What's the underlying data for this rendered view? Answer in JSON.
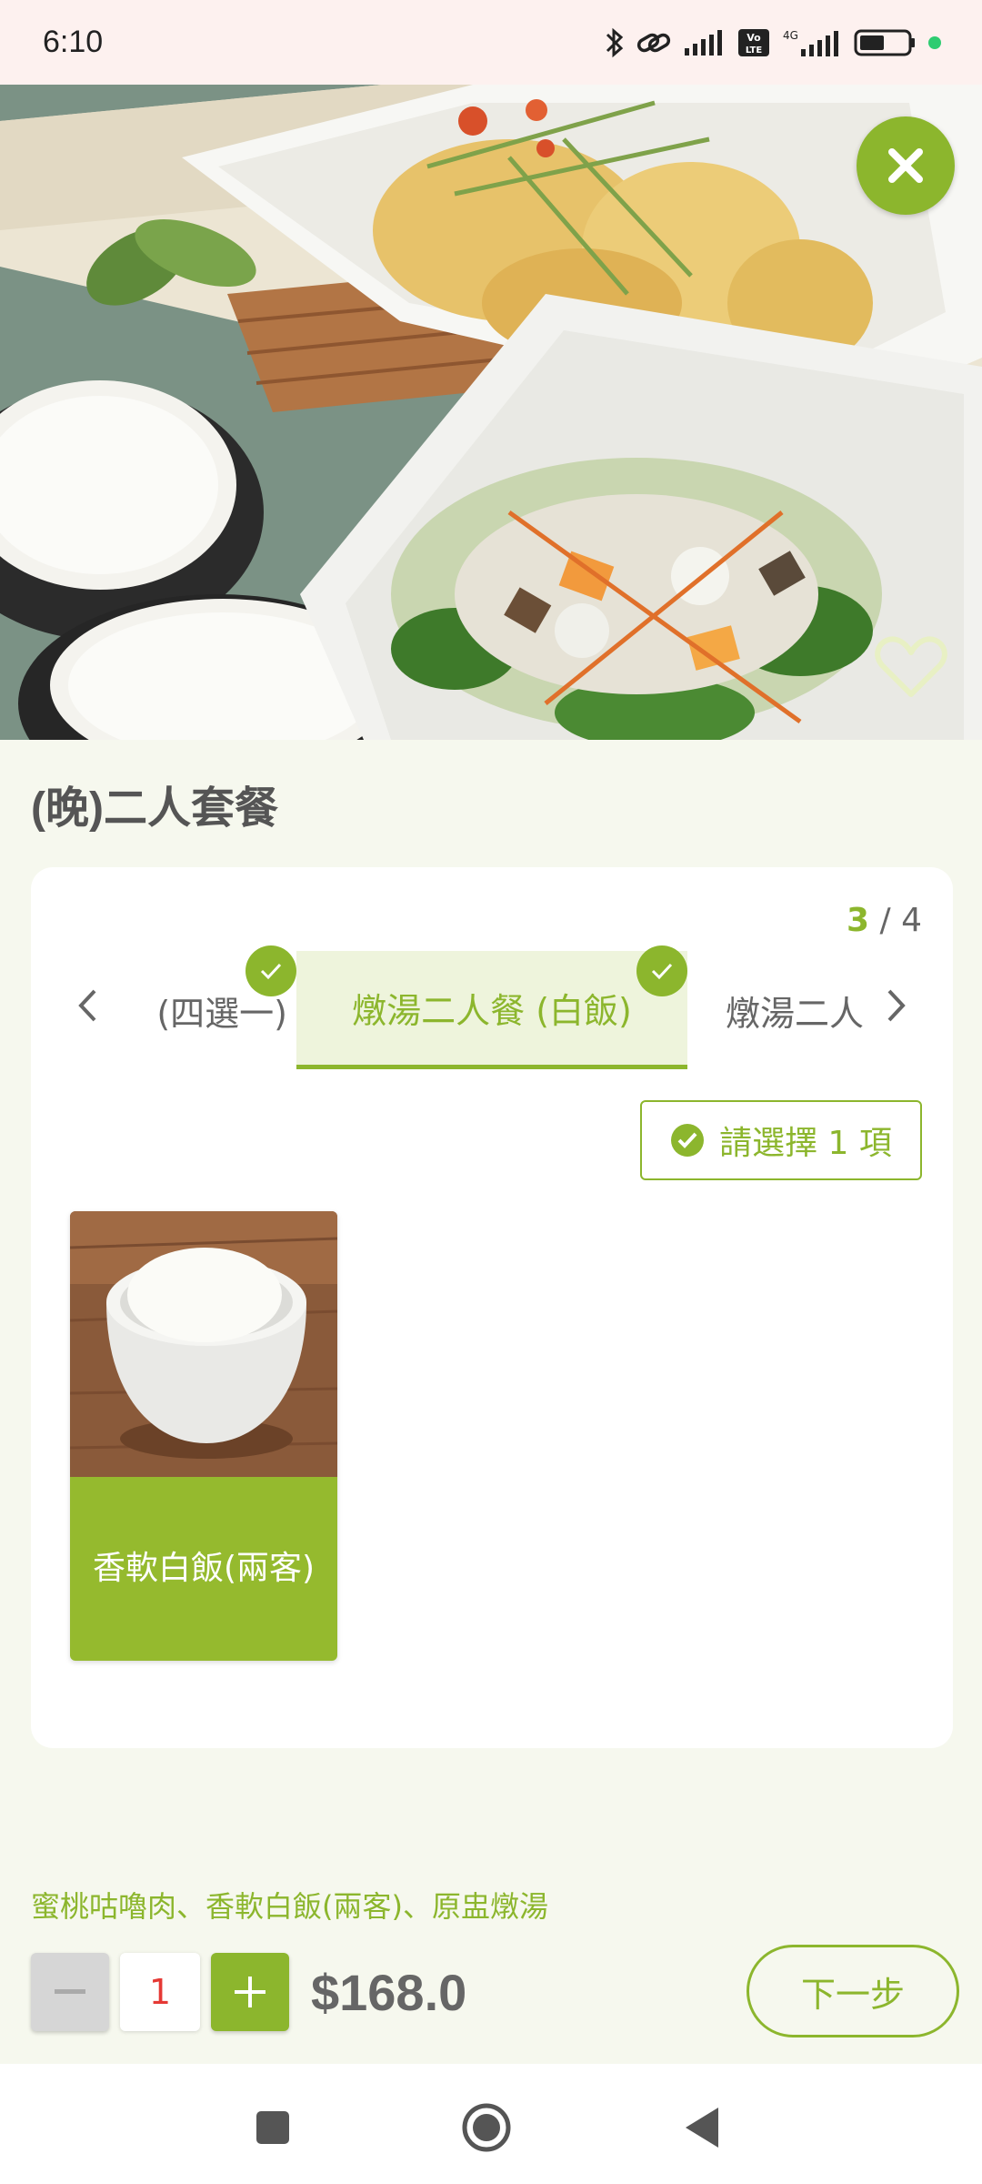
{
  "status_bar": {
    "time": "6:10",
    "network_label": "4G",
    "volte_label": "Vo LTE",
    "icons": [
      "bluetooth-icon",
      "link-icon",
      "signal-icon",
      "volte-icon",
      "signal-4g-icon",
      "battery-icon",
      "dot-icon"
    ]
  },
  "hero": {
    "image_icon": "food-photo",
    "close_icon": "close-icon",
    "favorite_icon": "heart-icon"
  },
  "product": {
    "title": "(晚)二人套餐"
  },
  "steps": {
    "current": "3",
    "separator": " / ",
    "total": "4",
    "prev_tab_label": "(四選一)",
    "active_tab_label": "燉湯二人餐 (白飯)",
    "next_tab_label": "燉湯二人",
    "prev_arrow_icon": "chevron-left-icon",
    "next_arrow_icon": "chevron-right-icon"
  },
  "selection": {
    "badge_label": "請選擇 1 項",
    "options": [
      {
        "label": "香軟白飯(兩客)",
        "image_icon": "rice-bowl-photo"
      }
    ]
  },
  "footer": {
    "summary": "蜜桃咕嚕肉、香軟白飯(兩客)、原盅燉湯",
    "quantity": "1",
    "price": "$168.0",
    "next_label": "下一步"
  },
  "colors": {
    "accent": "#8cb62d",
    "qty_text": "#e53935",
    "status_bar_bg": "#fdf1ef",
    "page_bg": "#f6f8ee"
  }
}
